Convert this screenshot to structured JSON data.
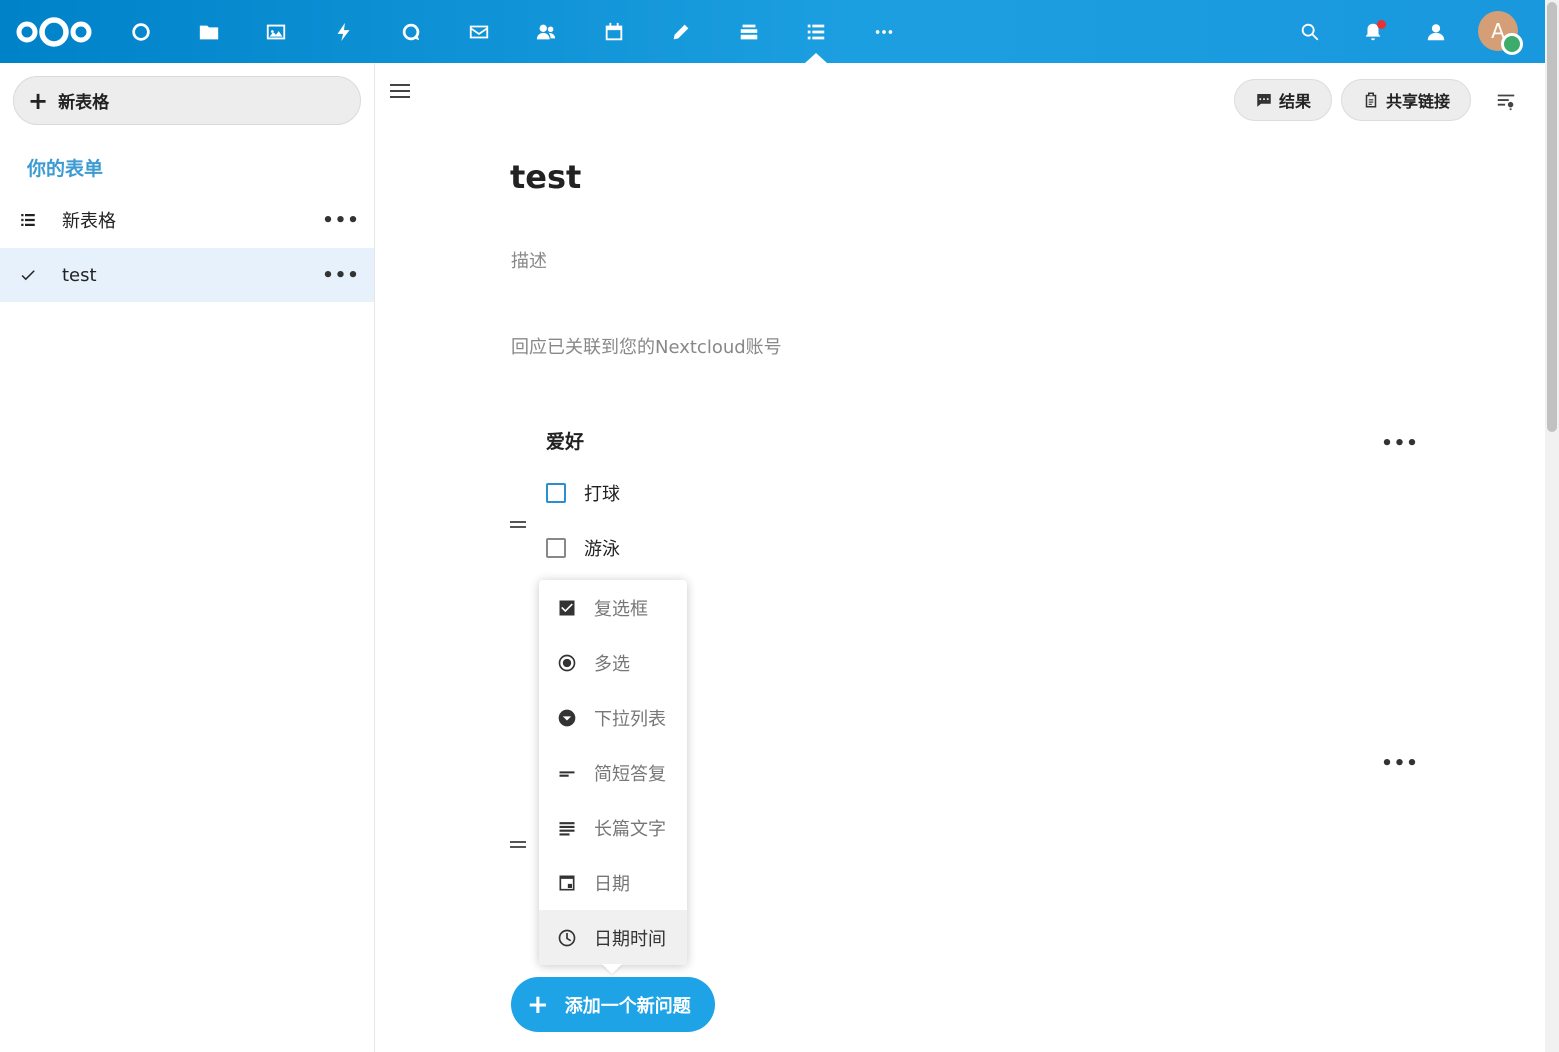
{
  "header": {
    "apps": [
      {
        "name": "dashboard",
        "icon": "circle-icon"
      },
      {
        "name": "files",
        "icon": "folder-icon"
      },
      {
        "name": "photos",
        "icon": "image-icon"
      },
      {
        "name": "activity",
        "icon": "lightning-icon"
      },
      {
        "name": "talk",
        "icon": "chat-icon"
      },
      {
        "name": "mail",
        "icon": "mail-icon"
      },
      {
        "name": "contacts",
        "icon": "contacts-icon"
      },
      {
        "name": "calendar",
        "icon": "calendar-icon"
      },
      {
        "name": "notes",
        "icon": "pencil-icon"
      },
      {
        "name": "deck",
        "icon": "deck-icon"
      },
      {
        "name": "forms",
        "icon": "list-icon",
        "active": true
      },
      {
        "name": "more",
        "icon": "more-icon"
      }
    ],
    "avatar_letter": "A",
    "colors": {
      "header": "#0082c9",
      "accent": "#1ea3e6"
    }
  },
  "sidebar": {
    "new_form_label": "新表格",
    "section_caption": "你的表单",
    "items": [
      {
        "label": "新表格",
        "icon": "list-icon",
        "active": false
      },
      {
        "label": "test",
        "icon": "check-icon",
        "active": true
      }
    ]
  },
  "toolbar": {
    "results_label": "结果",
    "share_link_label": "共享链接"
  },
  "form": {
    "title": "test",
    "description": "描述",
    "info": "回应已关联到您的Nextcloud账号",
    "question": {
      "title": "爱好",
      "options": [
        "打球",
        "游泳"
      ]
    }
  },
  "question_type_menu": {
    "items": [
      {
        "label": "复选框",
        "icon": "checkbox-checked-icon"
      },
      {
        "label": "多选",
        "icon": "radio-icon"
      },
      {
        "label": "下拉列表",
        "icon": "dropdown-icon"
      },
      {
        "label": "简短答复",
        "icon": "short-text-icon"
      },
      {
        "label": "长篇文字",
        "icon": "long-text-icon"
      },
      {
        "label": "日期",
        "icon": "date-icon"
      },
      {
        "label": "日期时间",
        "icon": "clock-icon",
        "hover": true
      }
    ]
  },
  "add_question_label": "添加一个新问题"
}
